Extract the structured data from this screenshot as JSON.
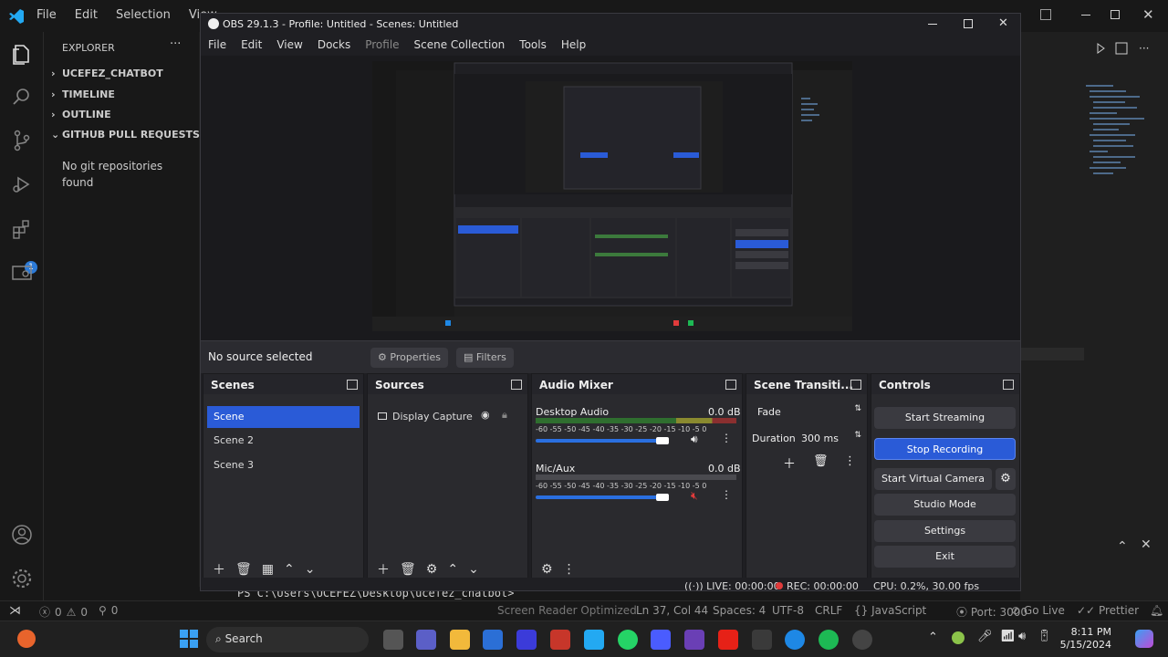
{
  "vscode": {
    "menu": [
      "File",
      "Edit",
      "Selection",
      "View"
    ],
    "explorer_title": "EXPLORER",
    "sections": [
      "UCEFEZ_CHATBOT",
      "TIMELINE",
      "OUTLINE",
      "GITHUB PULL REQUESTS: ..."
    ],
    "no_repos": "No git repositories found",
    "terminal_line": "PS C:\\Users\\UCEFEZ\\Desktop\\ucefez_chatbot>",
    "status": {
      "errors": "0",
      "warnings": "0",
      "ports": "0",
      "screen_reader": "Screen Reader Optimized",
      "position": "Ln 37, Col 44",
      "spaces": "Spaces: 4",
      "encoding": "UTF-8",
      "eol": "CRLF",
      "language": "JavaScript",
      "port": "Port: 3000",
      "golive": "Go Live",
      "prettier": "Prettier"
    }
  },
  "obs": {
    "title": "OBS 29.1.3 - Profile: Untitled - Scenes: Untitled",
    "menu": [
      "File",
      "Edit",
      "View",
      "Docks",
      "Profile",
      "Scene Collection",
      "Tools",
      "Help"
    ],
    "no_source": "No source selected",
    "properties": "Properties",
    "filters": "Filters",
    "scenes_title": "Scenes",
    "scenes": [
      "Scene",
      "Scene 2",
      "Scene 3"
    ],
    "sources_title": "Sources",
    "sources": [
      "Display Capture"
    ],
    "mixer_title": "Audio Mixer",
    "channels": [
      {
        "name": "Desktop Audio",
        "db": "0.0 dB",
        "volume": 0.85,
        "muted": false
      },
      {
        "name": "Mic/Aux",
        "db": "0.0 dB",
        "volume": 0.85,
        "muted": true
      }
    ],
    "meter_scale": "-60 -55 -50 -45 -40 -35 -30 -25 -20 -15 -10 -5 0",
    "transitions_title": "Scene Transiti...",
    "transition": "Fade",
    "duration_label": "Duration",
    "duration": "300 ms",
    "controls_title": "Controls",
    "controls": {
      "start_streaming": "Start Streaming",
      "stop_recording": "Stop Recording",
      "start_virtual_camera": "Start Virtual Camera",
      "studio_mode": "Studio Mode",
      "settings": "Settings",
      "exit": "Exit"
    },
    "status": {
      "live": "LIVE: 00:00:00",
      "rec": "REC: 00:00:00",
      "cpu": "CPU: 0.2%, 30.00 fps"
    },
    "colors": {
      "accent": "#2a5bd7",
      "rec": "#e03b3b",
      "panel": "#2a2a2e"
    }
  },
  "taskbar": {
    "search": "Search",
    "time": "8:11 PM",
    "date": "5/15/2024"
  }
}
